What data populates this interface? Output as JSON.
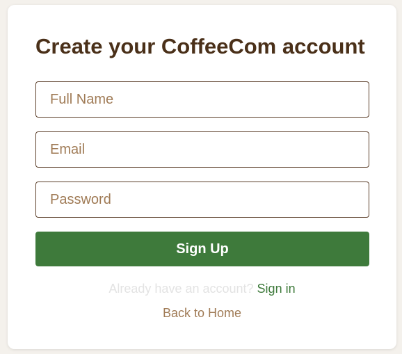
{
  "signup_form": {
    "title": "Create your CoffeeCom account",
    "full_name": {
      "placeholder": "Full Name",
      "value": ""
    },
    "email": {
      "placeholder": "Email",
      "value": ""
    },
    "password": {
      "placeholder": "Password",
      "value": ""
    },
    "submit_label": "Sign Up"
  },
  "footer": {
    "signin_prompt": "Already have an account?",
    "signin_link": "Sign in",
    "home_link": "Back to Home"
  },
  "colors": {
    "heading": "#4a3019",
    "accent_green": "#3e7a3b",
    "placeholder_brown": "#a07b56",
    "field_border": "#5a3d28"
  }
}
